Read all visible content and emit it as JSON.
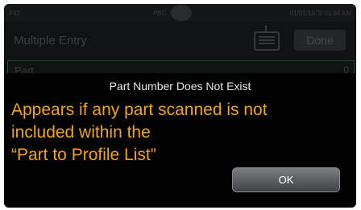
{
  "statusbar": {
    "left_text": "P41",
    "center_text": "PBC",
    "right_text": "01/01/1970 01:34 AM"
  },
  "header": {
    "title": "Multiple Entry",
    "done_label": "Done"
  },
  "part_row": {
    "label": "Part",
    "value": "",
    "count": "0"
  },
  "dialog": {
    "title": "Part Number Does Not Exist",
    "ok_label": "OK"
  },
  "annotation": {
    "line1": "Appears if any part  scanned is not",
    "line2": "included within the",
    "line3": "“Part to Profile List”",
    "color": "#f2a516"
  }
}
